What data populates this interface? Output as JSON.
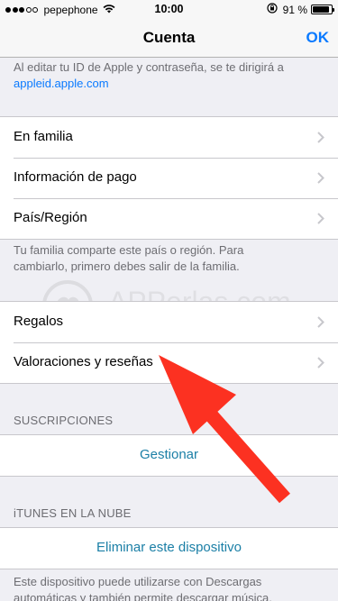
{
  "status_bar": {
    "carrier": "pepephone",
    "time": "10:00",
    "battery": "91 %",
    "battery_level": 0.91,
    "icons": [
      "signal-dots",
      "wifi-icon",
      "rotation-lock-icon",
      "battery-icon"
    ]
  },
  "nav": {
    "title": "Cuenta",
    "ok_label": "OK"
  },
  "top_note": {
    "text": "Al editar tu ID de Apple y contraseña, se te dirigirá a",
    "link": "appleid.apple.com"
  },
  "group1": {
    "items": [
      {
        "label": "En familia"
      },
      {
        "label": "Información de pago"
      },
      {
        "label": "País/Región"
      }
    ]
  },
  "family_note": {
    "line1": "Tu familia comparte este país o región. Para",
    "line2": "cambiarlo, primero debes salir de la familia."
  },
  "watermark": {
    "text": "APPerlas.com"
  },
  "group2": {
    "items": [
      {
        "label": "Regalos"
      },
      {
        "label": "Valoraciones y reseñas"
      }
    ]
  },
  "subscriptions": {
    "header": "SUSCRIPCIONES",
    "action": "Gestionar"
  },
  "itunes_cloud": {
    "header": "iTUNES EN LA NUBE",
    "action": "Eliminar este dispositivo"
  },
  "bottom_note": {
    "line1": "Este dispositivo puede utilizarse con Descargas",
    "line2": "automáticas y también permite descargar música,"
  },
  "colors": {
    "accent": "#0a7aff",
    "teal_action": "#1b7fa6",
    "annotation_arrow": "#fc3121",
    "background": "#efeff4"
  }
}
